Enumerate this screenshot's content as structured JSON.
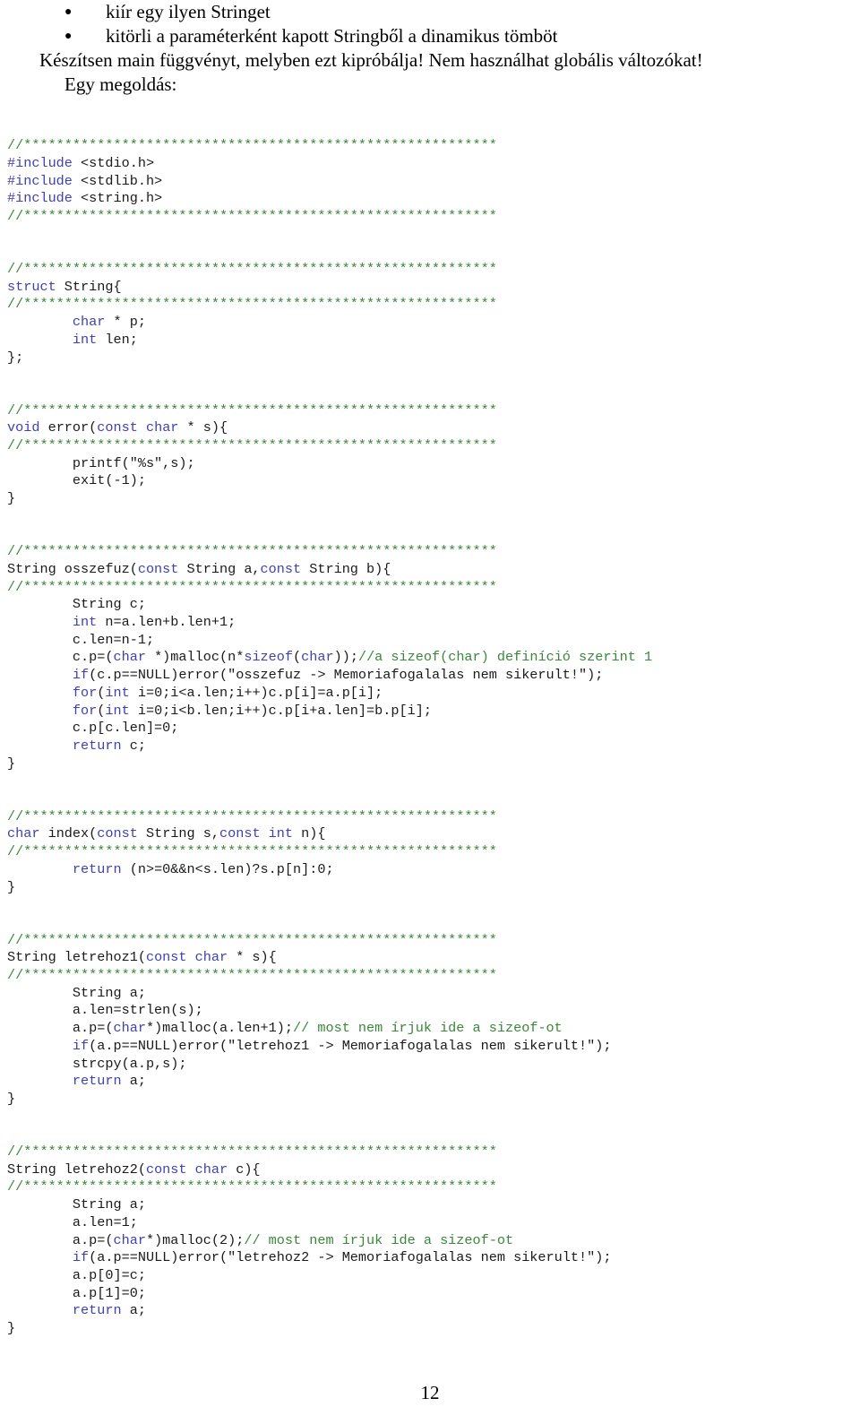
{
  "document": {
    "page_number": "12",
    "language": "hu"
  },
  "colors": {
    "comment_green": "#3a873a",
    "keyword_blue": "#4040b4",
    "text_black": "#1a1a1a",
    "background": "#ffffff"
  },
  "prose": {
    "bullets": [
      {
        "glyph": "●",
        "text": "kiír egy ilyen Stringet"
      },
      {
        "glyph": "●",
        "text": "kitörli a paraméterként kapott Stringből a dinamikus tömböt"
      }
    ],
    "paragraphs": [
      "Készítsen main függvényt, melyben ezt kipróbálja! Nem használhat globális változókat!",
      "Egy megoldás:"
    ]
  },
  "code": {
    "separator": "//**********************************************************",
    "lines": [
      {
        "id": "l01",
        "segments": [
          {
            "cls": "cm",
            "t": "//**********************************************************"
          }
        ]
      },
      {
        "id": "l02",
        "segments": [
          {
            "cls": "kw",
            "t": "#include"
          },
          {
            "cls": "id",
            "t": " <stdio.h>"
          }
        ]
      },
      {
        "id": "l03",
        "segments": [
          {
            "cls": "kw",
            "t": "#include"
          },
          {
            "cls": "id",
            "t": " <stdlib.h>"
          }
        ]
      },
      {
        "id": "l04",
        "segments": [
          {
            "cls": "kw",
            "t": "#include"
          },
          {
            "cls": "id",
            "t": " <string.h>"
          }
        ]
      },
      {
        "id": "l05",
        "segments": [
          {
            "cls": "cm",
            "t": "//**********************************************************"
          }
        ]
      },
      {
        "id": "l06",
        "segments": []
      },
      {
        "id": "l07",
        "segments": []
      },
      {
        "id": "l08",
        "segments": [
          {
            "cls": "cm",
            "t": "//**********************************************************"
          }
        ]
      },
      {
        "id": "l09",
        "segments": [
          {
            "cls": "kw",
            "t": "struct"
          },
          {
            "cls": "id",
            "t": " String{"
          }
        ]
      },
      {
        "id": "l10",
        "segments": [
          {
            "cls": "cm",
            "t": "//**********************************************************"
          }
        ]
      },
      {
        "id": "l11",
        "segments": [
          {
            "cls": "id",
            "t": "        "
          },
          {
            "cls": "kw",
            "t": "char"
          },
          {
            "cls": "id",
            "t": " * p;"
          }
        ]
      },
      {
        "id": "l12",
        "segments": [
          {
            "cls": "id",
            "t": "        "
          },
          {
            "cls": "kw",
            "t": "int"
          },
          {
            "cls": "id",
            "t": " len;"
          }
        ]
      },
      {
        "id": "l13",
        "segments": [
          {
            "cls": "id",
            "t": "};"
          }
        ]
      },
      {
        "id": "l14",
        "segments": []
      },
      {
        "id": "l15",
        "segments": []
      },
      {
        "id": "l16",
        "segments": [
          {
            "cls": "cm",
            "t": "//**********************************************************"
          }
        ]
      },
      {
        "id": "l17",
        "segments": [
          {
            "cls": "kw",
            "t": "void"
          },
          {
            "cls": "id",
            "t": " error("
          },
          {
            "cls": "kw",
            "t": "const char"
          },
          {
            "cls": "id",
            "t": " * s){"
          }
        ]
      },
      {
        "id": "l18",
        "segments": [
          {
            "cls": "cm",
            "t": "//**********************************************************"
          }
        ]
      },
      {
        "id": "l19",
        "segments": [
          {
            "cls": "id",
            "t": "        printf(\"%s\",s);"
          }
        ]
      },
      {
        "id": "l20",
        "segments": [
          {
            "cls": "id",
            "t": "        exit(-1);"
          }
        ]
      },
      {
        "id": "l21",
        "segments": [
          {
            "cls": "id",
            "t": "}"
          }
        ]
      },
      {
        "id": "l22",
        "segments": []
      },
      {
        "id": "l23",
        "segments": []
      },
      {
        "id": "l24",
        "segments": [
          {
            "cls": "cm",
            "t": "//**********************************************************"
          }
        ]
      },
      {
        "id": "l25",
        "segments": [
          {
            "cls": "id",
            "t": "String osszefuz("
          },
          {
            "cls": "kw",
            "t": "const"
          },
          {
            "cls": "id",
            "t": " String a,"
          },
          {
            "cls": "kw",
            "t": "const"
          },
          {
            "cls": "id",
            "t": " String b){"
          }
        ]
      },
      {
        "id": "l26",
        "segments": [
          {
            "cls": "cm",
            "t": "//**********************************************************"
          }
        ]
      },
      {
        "id": "l27",
        "segments": [
          {
            "cls": "id",
            "t": "        String c;"
          }
        ]
      },
      {
        "id": "l28",
        "segments": [
          {
            "cls": "id",
            "t": "        "
          },
          {
            "cls": "kw",
            "t": "int"
          },
          {
            "cls": "id",
            "t": " n=a.len+b.len+1;"
          }
        ]
      },
      {
        "id": "l29",
        "segments": [
          {
            "cls": "id",
            "t": "        c.len=n-1;"
          }
        ]
      },
      {
        "id": "l30",
        "segments": [
          {
            "cls": "id",
            "t": "        c.p=("
          },
          {
            "cls": "kw",
            "t": "char"
          },
          {
            "cls": "id",
            "t": " *)malloc(n*"
          },
          {
            "cls": "kw",
            "t": "sizeof"
          },
          {
            "cls": "id",
            "t": "("
          },
          {
            "cls": "kw",
            "t": "char"
          },
          {
            "cls": "id",
            "t": "));"
          },
          {
            "cls": "cm",
            "t": "//a sizeof(char) definíció szerint 1"
          }
        ]
      },
      {
        "id": "l31",
        "segments": [
          {
            "cls": "id",
            "t": "        "
          },
          {
            "cls": "kw",
            "t": "if"
          },
          {
            "cls": "id",
            "t": "(c.p==NULL)error(\"osszefuz -> Memoriafogalalas nem sikerult!\");"
          }
        ]
      },
      {
        "id": "l32",
        "segments": [
          {
            "cls": "id",
            "t": "        "
          },
          {
            "cls": "kw",
            "t": "for"
          },
          {
            "cls": "id",
            "t": "("
          },
          {
            "cls": "kw",
            "t": "int"
          },
          {
            "cls": "id",
            "t": " i=0;i<a.len;i++)c.p[i]=a.p[i];"
          }
        ]
      },
      {
        "id": "l33",
        "segments": [
          {
            "cls": "id",
            "t": "        "
          },
          {
            "cls": "kw",
            "t": "for"
          },
          {
            "cls": "id",
            "t": "("
          },
          {
            "cls": "kw",
            "t": "int"
          },
          {
            "cls": "id",
            "t": " i=0;i<b.len;i++)c.p[i+a.len]=b.p[i];"
          }
        ]
      },
      {
        "id": "l34",
        "segments": [
          {
            "cls": "id",
            "t": "        c.p[c.len]=0;"
          }
        ]
      },
      {
        "id": "l35",
        "segments": [
          {
            "cls": "id",
            "t": "        "
          },
          {
            "cls": "kw",
            "t": "return"
          },
          {
            "cls": "id",
            "t": " c;"
          }
        ]
      },
      {
        "id": "l36",
        "segments": [
          {
            "cls": "id",
            "t": "}"
          }
        ]
      },
      {
        "id": "l37",
        "segments": []
      },
      {
        "id": "l38",
        "segments": []
      },
      {
        "id": "l39",
        "segments": [
          {
            "cls": "cm",
            "t": "//**********************************************************"
          }
        ]
      },
      {
        "id": "l40",
        "segments": [
          {
            "cls": "kw",
            "t": "char"
          },
          {
            "cls": "id",
            "t": " index("
          },
          {
            "cls": "kw",
            "t": "const"
          },
          {
            "cls": "id",
            "t": " String s,"
          },
          {
            "cls": "kw",
            "t": "const int"
          },
          {
            "cls": "id",
            "t": " n){"
          }
        ]
      },
      {
        "id": "l41",
        "segments": [
          {
            "cls": "cm",
            "t": "//**********************************************************"
          }
        ]
      },
      {
        "id": "l42",
        "segments": [
          {
            "cls": "id",
            "t": "        "
          },
          {
            "cls": "kw",
            "t": "return"
          },
          {
            "cls": "id",
            "t": " (n>=0&&n<s.len)?s.p[n]:0;"
          }
        ]
      },
      {
        "id": "l43",
        "segments": [
          {
            "cls": "id",
            "t": "}"
          }
        ]
      },
      {
        "id": "l44",
        "segments": []
      },
      {
        "id": "l45",
        "segments": []
      },
      {
        "id": "l46",
        "segments": [
          {
            "cls": "cm",
            "t": "//**********************************************************"
          }
        ]
      },
      {
        "id": "l47",
        "segments": [
          {
            "cls": "id",
            "t": "String letrehoz1("
          },
          {
            "cls": "kw",
            "t": "const char"
          },
          {
            "cls": "id",
            "t": " * s){"
          }
        ]
      },
      {
        "id": "l48",
        "segments": [
          {
            "cls": "cm",
            "t": "//**********************************************************"
          }
        ]
      },
      {
        "id": "l49",
        "segments": [
          {
            "cls": "id",
            "t": "        String a;"
          }
        ]
      },
      {
        "id": "l50",
        "segments": [
          {
            "cls": "id",
            "t": "        a.len=strlen(s);"
          }
        ]
      },
      {
        "id": "l51",
        "segments": [
          {
            "cls": "id",
            "t": "        a.p=("
          },
          {
            "cls": "kw",
            "t": "char"
          },
          {
            "cls": "id",
            "t": "*)malloc(a.len+1);"
          },
          {
            "cls": "cm",
            "t": "// most nem írjuk ide a sizeof-ot"
          }
        ]
      },
      {
        "id": "l52",
        "segments": [
          {
            "cls": "id",
            "t": "        "
          },
          {
            "cls": "kw",
            "t": "if"
          },
          {
            "cls": "id",
            "t": "(a.p==NULL)error(\"letrehoz1 -> Memoriafogalalas nem sikerult!\");"
          }
        ]
      },
      {
        "id": "l53",
        "segments": [
          {
            "cls": "id",
            "t": "        strcpy(a.p,s);"
          }
        ]
      },
      {
        "id": "l54",
        "segments": [
          {
            "cls": "id",
            "t": "        "
          },
          {
            "cls": "kw",
            "t": "return"
          },
          {
            "cls": "id",
            "t": " a;"
          }
        ]
      },
      {
        "id": "l55",
        "segments": [
          {
            "cls": "id",
            "t": "}"
          }
        ]
      },
      {
        "id": "l56",
        "segments": []
      },
      {
        "id": "l57",
        "segments": []
      },
      {
        "id": "l58",
        "segments": [
          {
            "cls": "cm",
            "t": "//**********************************************************"
          }
        ]
      },
      {
        "id": "l59",
        "segments": [
          {
            "cls": "id",
            "t": "String letrehoz2("
          },
          {
            "cls": "kw",
            "t": "const char"
          },
          {
            "cls": "id",
            "t": " c){"
          }
        ]
      },
      {
        "id": "l60",
        "segments": [
          {
            "cls": "cm",
            "t": "//**********************************************************"
          }
        ]
      },
      {
        "id": "l61",
        "segments": [
          {
            "cls": "id",
            "t": "        String a;"
          }
        ]
      },
      {
        "id": "l62",
        "segments": [
          {
            "cls": "id",
            "t": "        a.len=1;"
          }
        ]
      },
      {
        "id": "l63",
        "segments": [
          {
            "cls": "id",
            "t": "        a.p=("
          },
          {
            "cls": "kw",
            "t": "char"
          },
          {
            "cls": "id",
            "t": "*)malloc(2);"
          },
          {
            "cls": "cm",
            "t": "// most nem írjuk ide a sizeof-ot"
          }
        ]
      },
      {
        "id": "l64",
        "segments": [
          {
            "cls": "id",
            "t": "        "
          },
          {
            "cls": "kw",
            "t": "if"
          },
          {
            "cls": "id",
            "t": "(a.p==NULL)error(\"letrehoz2 -> Memoriafogalalas nem sikerult!\");"
          }
        ]
      },
      {
        "id": "l65",
        "segments": [
          {
            "cls": "id",
            "t": "        a.p[0]=c;"
          }
        ]
      },
      {
        "id": "l66",
        "segments": [
          {
            "cls": "id",
            "t": "        a.p[1]=0;"
          }
        ]
      },
      {
        "id": "l67",
        "segments": [
          {
            "cls": "id",
            "t": "        "
          },
          {
            "cls": "kw",
            "t": "return"
          },
          {
            "cls": "id",
            "t": " a;"
          }
        ]
      },
      {
        "id": "l68",
        "segments": [
          {
            "cls": "id",
            "t": "}"
          }
        ]
      }
    ]
  }
}
